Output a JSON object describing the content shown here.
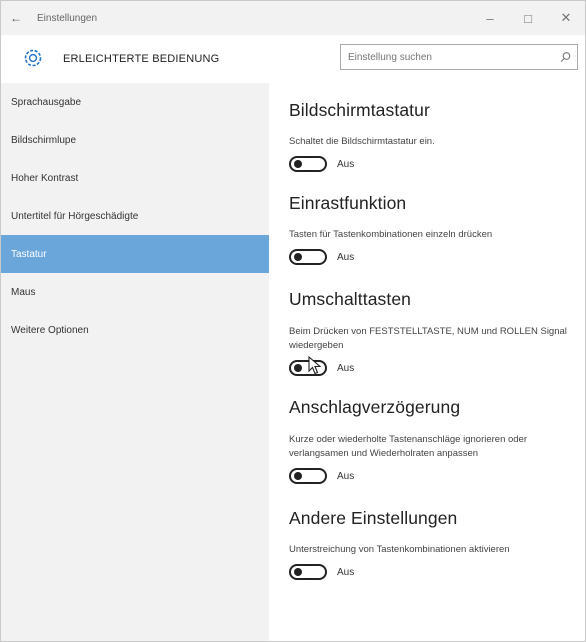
{
  "titlebar": {
    "back_icon": "back-arrow-icon",
    "title": "Einstellungen",
    "minimize_icon": "minimize-icon",
    "maximize_icon": "maximize-icon",
    "close_icon": "close-icon"
  },
  "header": {
    "icon": "ease-of-access-gear-icon",
    "title": "ERLEICHTERTE BEDIENUNG",
    "search_placeholder": "Einstellung suchen",
    "search_icon": "search-icon"
  },
  "sidebar": {
    "items": [
      {
        "label": "Sprachausgabe",
        "active": false
      },
      {
        "label": "Bildschirmlupe",
        "active": false
      },
      {
        "label": "Hoher Kontrast",
        "active": false
      },
      {
        "label": "Untertitel für Hörgeschädigte",
        "active": false
      },
      {
        "label": "Tastatur",
        "active": true
      },
      {
        "label": "Maus",
        "active": false
      },
      {
        "label": "Weitere Optionen",
        "active": false
      }
    ]
  },
  "main": {
    "sections": [
      {
        "title": "Bildschirmtastatur",
        "desc": "Schaltet die Bildschirmtastatur ein.",
        "toggle": "Aus"
      },
      {
        "title": "Einrastfunktion",
        "desc": "Tasten für Tastenkombinationen einzeln drücken",
        "toggle": "Aus"
      },
      {
        "title": "Umschalttasten",
        "desc": "Beim Drücken von FESTSTELLTASTE, NUM und ROLLEN Signal wiedergeben",
        "toggle": "Aus"
      },
      {
        "title": "Anschlagverzögerung",
        "desc": "Kurze oder wiederholte Tastenanschläge ignorieren oder verlangsamen und Wiederholraten anpassen",
        "toggle": "Aus"
      },
      {
        "title": "Andere Einstellungen",
        "desc": "Unterstreichung von Tastenkombinationen aktivieren",
        "toggle": "Aus"
      }
    ]
  },
  "colors": {
    "accent": "#6aa6da",
    "sidebar_bg": "#f2f2f2",
    "titlebar_bg": "#f2f2f2"
  }
}
